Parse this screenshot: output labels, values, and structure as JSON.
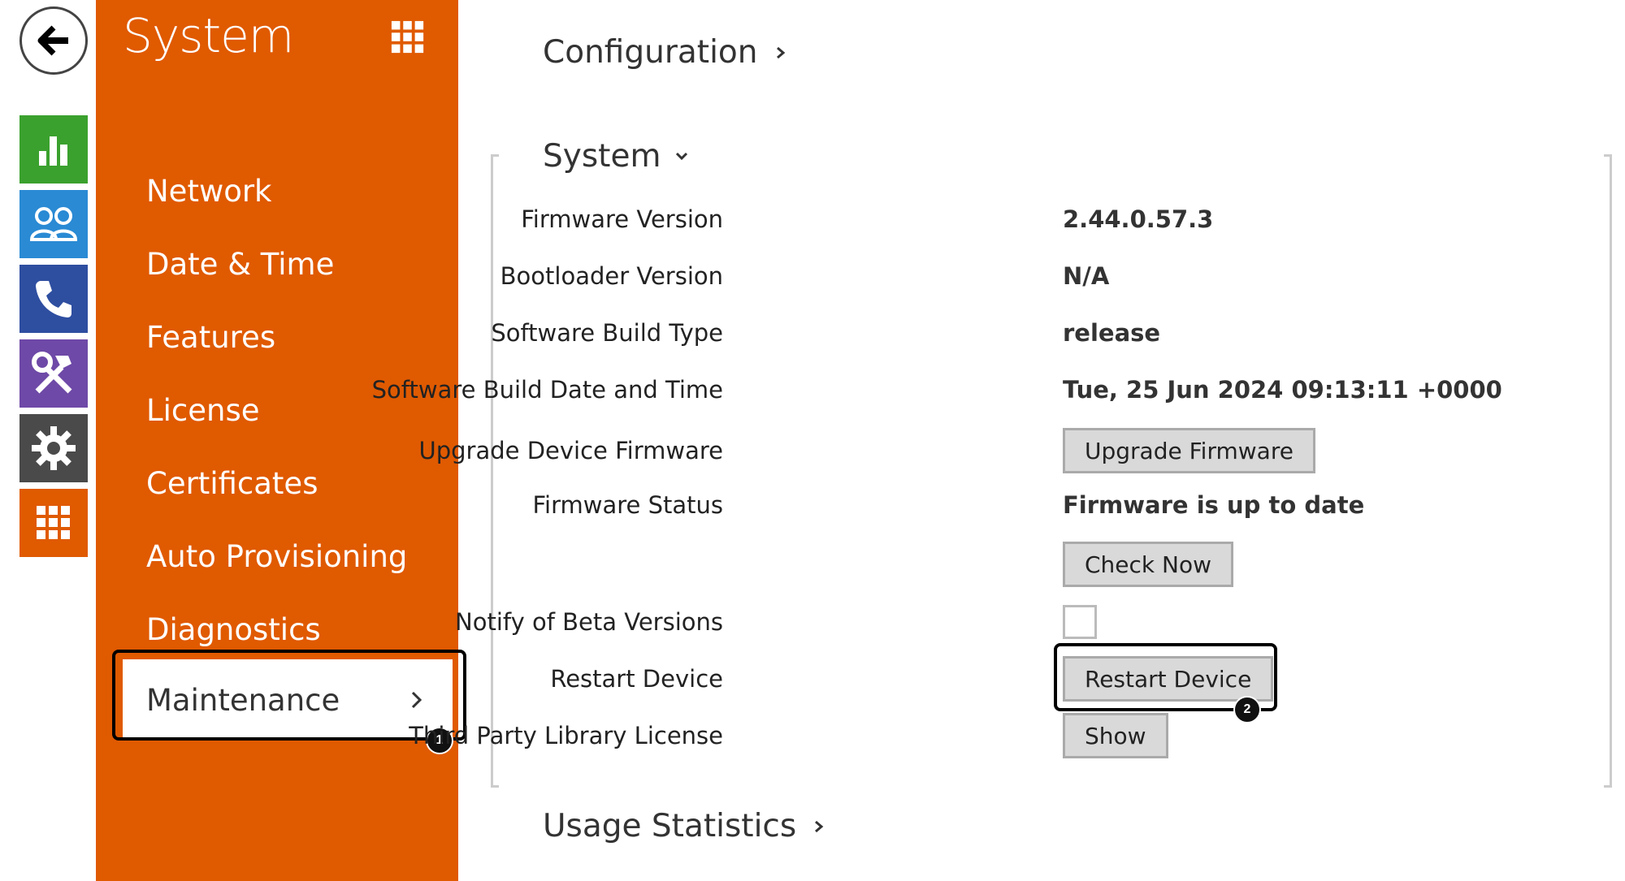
{
  "panel": {
    "title": "System",
    "nav_items": [
      {
        "label": "Network"
      },
      {
        "label": "Date & Time"
      },
      {
        "label": "Features"
      },
      {
        "label": "License"
      },
      {
        "label": "Certificates"
      },
      {
        "label": "Auto Provisioning"
      },
      {
        "label": "Diagnostics"
      },
      {
        "label": "Maintenance",
        "active": true
      }
    ]
  },
  "rail": {
    "tiles": [
      {
        "icon": "bar-chart-icon",
        "color": "#3aa12e"
      },
      {
        "icon": "users-icon",
        "color": "#2a8ad4"
      },
      {
        "icon": "phone-icon",
        "color": "#2e4ea0"
      },
      {
        "icon": "tools-icon",
        "color": "#6e49a7"
      },
      {
        "icon": "gear-icon",
        "color": "#4a4a4a"
      },
      {
        "icon": "apps-grid-icon",
        "color": "#e05a00"
      }
    ]
  },
  "main": {
    "configuration_heading": "Configuration",
    "system_heading": "System",
    "usage_heading": "Usage Statistics",
    "rows": {
      "firmware_version": {
        "label": "Firmware Version",
        "value": "2.44.0.57.3"
      },
      "bootloader_version": {
        "label": "Bootloader Version",
        "value": "N/A"
      },
      "build_type": {
        "label": "Software Build Type",
        "value": "release"
      },
      "build_date": {
        "label": "Software Build Date and Time",
        "value": "Tue, 25 Jun 2024 09:13:11 +0000"
      },
      "upgrade": {
        "label": "Upgrade Device Firmware",
        "button": "Upgrade Firmware"
      },
      "firmware_status": {
        "label": "Firmware Status",
        "value": "Firmware is up to date"
      },
      "check_now": {
        "button": "Check Now"
      },
      "notify_beta": {
        "label": "Notify of Beta Versions",
        "checked": false
      },
      "restart": {
        "label": "Restart Device",
        "button": "Restart Device"
      },
      "third_party": {
        "label": "Third Party Library License",
        "button": "Show"
      }
    }
  },
  "callouts": {
    "one": "1",
    "two": "2"
  },
  "colors": {
    "accent": "#e05a00",
    "highlight_border": "#000000"
  }
}
